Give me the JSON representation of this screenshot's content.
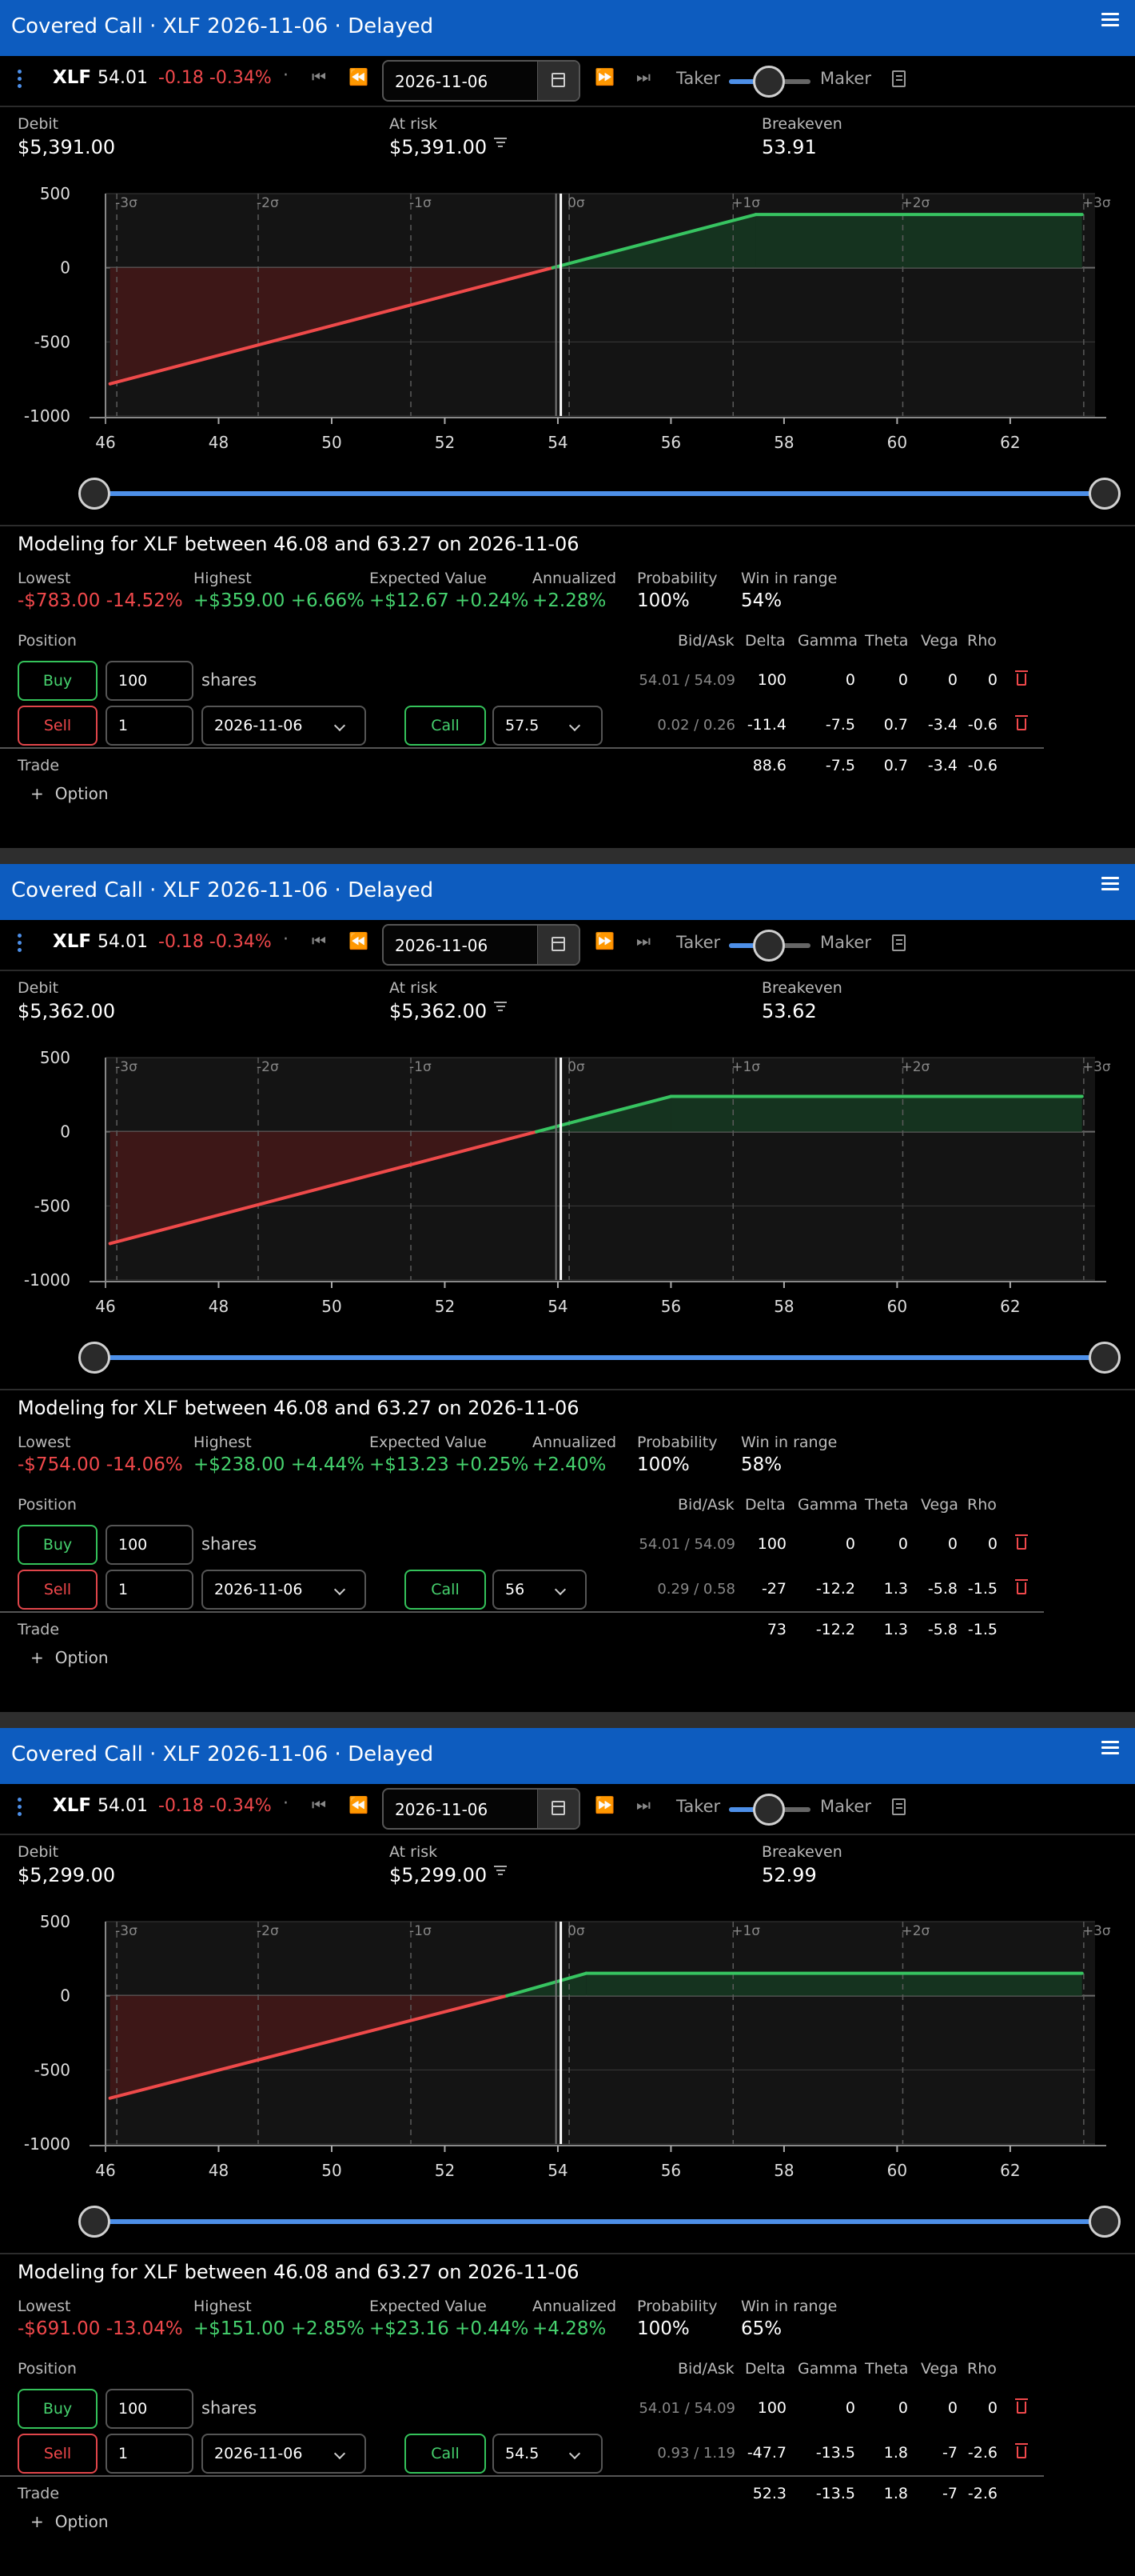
{
  "colors": {
    "title_bar": "#0d5cbf",
    "accent": "#4d8fe8",
    "profit_line": "#37c461",
    "loss_line": "#ef4a4a",
    "profit_fill": "#15331f",
    "loss_fill": "#3d1717",
    "negative_text": "#f0484b",
    "positive_text": "#46d26e"
  },
  "toolbar_labels": {
    "taker": "Taker",
    "maker": "Maker",
    "dot": "·"
  },
  "summary_labels": {
    "debit": "Debit",
    "at_risk": "At risk",
    "breakeven": "Breakeven"
  },
  "stat_labels": {
    "lowest": "Lowest",
    "highest": "Highest",
    "expected": "Expected Value",
    "annualized": "Annualized",
    "probability": "Probability",
    "win": "Win in range"
  },
  "table_headers": {
    "position": "Position",
    "bid_ask": "Bid/Ask",
    "delta": "Delta",
    "gamma": "Gamma",
    "theta": "Theta",
    "vega": "Vega",
    "rho": "Rho",
    "trade": "Trade",
    "add_option": "Option",
    "buy": "Buy",
    "sell": "Sell",
    "call": "Call",
    "shares": "shares"
  },
  "panels": [
    {
      "title": "Covered Call · XLF 2026-11-06 · Delayed",
      "symbol": "XLF",
      "last": "54.01",
      "change": "-0.18 -0.34%",
      "date": "2026-11-06",
      "debit": "$5,391.00",
      "at_risk": "$5,391.00",
      "breakeven": "53.91",
      "modeling": "Modeling for XLF between 46.08 and 63.27 on 2026-11-06",
      "lowest": "-$783.00 -14.52%",
      "highest": "+$359.00 +6.66%",
      "expected": "+$12.67 +0.24%",
      "annualized": "+2.28%",
      "probability": "100%",
      "win": "54%",
      "stock_row": {
        "qty": "100",
        "bid_ask": "54.01 / 54.09",
        "delta": "100",
        "gamma": "0",
        "theta": "0",
        "vega": "0",
        "rho": "0"
      },
      "option_row": {
        "qty": "1",
        "expiry": "2026-11-06",
        "strike": "57.5",
        "bid_ask": "0.02 / 0.26",
        "delta": "-11.4",
        "gamma": "-7.5",
        "theta": "0.7",
        "vega": "-3.4",
        "rho": "-0.6"
      },
      "trade_row": {
        "delta": "88.6",
        "gamma": "-7.5",
        "theta": "0.7",
        "vega": "-3.4",
        "rho": "-0.6"
      },
      "chart_data": {
        "type": "line",
        "series": [
          {
            "values": [
              [
                46.08,
                -783
              ],
              [
                57.5,
                359
              ],
              [
                63.27,
                359
              ]
            ]
          }
        ],
        "breakeven": 53.91,
        "current_price": 54.01,
        "xlim": [
          46,
          63.5
        ],
        "ylim": [
          -1000,
          500
        ],
        "x_ticks": [
          "46",
          "48",
          "50",
          "52",
          "54",
          "56",
          "58",
          "60",
          "62"
        ],
        "y_ticks": [
          "500",
          "0",
          "-500",
          "-1000"
        ],
        "sigma_values": [
          46.2,
          48.7,
          51.4,
          54.2,
          57.1,
          60.1,
          63.3
        ],
        "sigma_labels": [
          "-3σ",
          "-2σ",
          "-1σ",
          "0σ",
          "+1σ",
          "+2σ",
          "+3σ"
        ]
      }
    },
    {
      "title": "Covered Call · XLF 2026-11-06 · Delayed",
      "symbol": "XLF",
      "last": "54.01",
      "change": "-0.18 -0.34%",
      "date": "2026-11-06",
      "debit": "$5,362.00",
      "at_risk": "$5,362.00",
      "breakeven": "53.62",
      "modeling": "Modeling for XLF between 46.08 and 63.27 on 2026-11-06",
      "lowest": "-$754.00 -14.06%",
      "highest": "+$238.00 +4.44%",
      "expected": "+$13.23 +0.25%",
      "annualized": "+2.40%",
      "probability": "100%",
      "win": "58%",
      "stock_row": {
        "qty": "100",
        "bid_ask": "54.01 / 54.09",
        "delta": "100",
        "gamma": "0",
        "theta": "0",
        "vega": "0",
        "rho": "0"
      },
      "option_row": {
        "qty": "1",
        "expiry": "2026-11-06",
        "strike": "56",
        "bid_ask": "0.29 / 0.58",
        "delta": "-27",
        "gamma": "-12.2",
        "theta": "1.3",
        "vega": "-5.8",
        "rho": "-1.5"
      },
      "trade_row": {
        "delta": "73",
        "gamma": "-12.2",
        "theta": "1.3",
        "vega": "-5.8",
        "rho": "-1.5"
      },
      "chart_data": {
        "type": "line",
        "series": [
          {
            "values": [
              [
                46.08,
                -754
              ],
              [
                56,
                238
              ],
              [
                63.27,
                238
              ]
            ]
          }
        ],
        "breakeven": 53.62,
        "current_price": 54.01,
        "xlim": [
          46,
          63.5
        ],
        "ylim": [
          -1000,
          500
        ],
        "x_ticks": [
          "46",
          "48",
          "50",
          "52",
          "54",
          "56",
          "58",
          "60",
          "62"
        ],
        "y_ticks": [
          "500",
          "0",
          "-500",
          "-1000"
        ],
        "sigma_values": [
          46.2,
          48.7,
          51.4,
          54.2,
          57.1,
          60.1,
          63.3
        ],
        "sigma_labels": [
          "-3σ",
          "-2σ",
          "-1σ",
          "0σ",
          "+1σ",
          "+2σ",
          "+3σ"
        ]
      }
    },
    {
      "title": "Covered Call · XLF 2026-11-06 · Delayed",
      "symbol": "XLF",
      "last": "54.01",
      "change": "-0.18 -0.34%",
      "date": "2026-11-06",
      "debit": "$5,299.00",
      "at_risk": "$5,299.00",
      "breakeven": "52.99",
      "modeling": "Modeling for XLF between 46.08 and 63.27 on 2026-11-06",
      "lowest": "-$691.00 -13.04%",
      "highest": "+$151.00 +2.85%",
      "expected": "+$23.16 +0.44%",
      "annualized": "+4.28%",
      "probability": "100%",
      "win": "65%",
      "stock_row": {
        "qty": "100",
        "bid_ask": "54.01 / 54.09",
        "delta": "100",
        "gamma": "0",
        "theta": "0",
        "vega": "0",
        "rho": "0"
      },
      "option_row": {
        "qty": "1",
        "expiry": "2026-11-06",
        "strike": "54.5",
        "bid_ask": "0.93 / 1.19",
        "delta": "-47.7",
        "gamma": "-13.5",
        "theta": "1.8",
        "vega": "-7",
        "rho": "-2.6"
      },
      "trade_row": {
        "delta": "52.3",
        "gamma": "-13.5",
        "theta": "1.8",
        "vega": "-7",
        "rho": "-2.6"
      },
      "chart_data": {
        "type": "line",
        "series": [
          {
            "values": [
              [
                46.08,
                -691
              ],
              [
                53.1,
                0
              ],
              [
                54.5,
                151
              ],
              [
                63.27,
                151
              ]
            ]
          }
        ],
        "breakeven": 52.99,
        "current_price": 54.01,
        "xlim": [
          46,
          63.5
        ],
        "ylim": [
          -1000,
          500
        ],
        "x_ticks": [
          "46",
          "48",
          "50",
          "52",
          "54",
          "56",
          "58",
          "60",
          "62"
        ],
        "y_ticks": [
          "500",
          "0",
          "-500",
          "-1000"
        ],
        "sigma_values": [
          46.2,
          48.7,
          51.4,
          54.2,
          57.1,
          60.1,
          63.3
        ],
        "sigma_labels": [
          "-3σ",
          "-2σ",
          "-1σ",
          "0σ",
          "+1σ",
          "+2σ",
          "+3σ"
        ]
      }
    }
  ]
}
